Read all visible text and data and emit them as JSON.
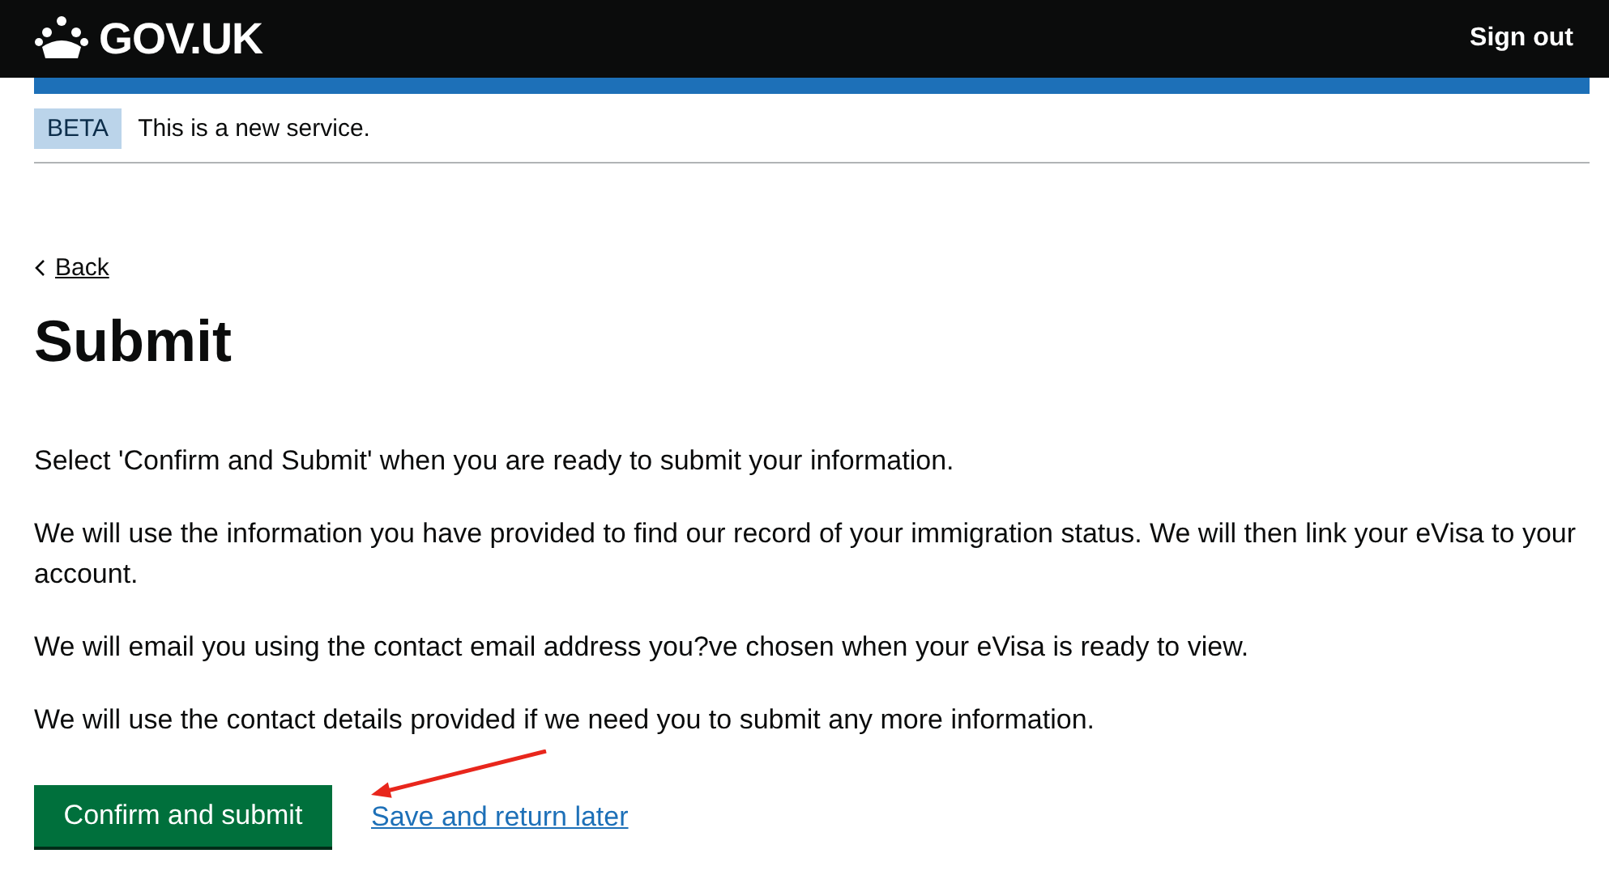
{
  "header": {
    "logo": "GOV.UK",
    "sign_out": "Sign out"
  },
  "phase_banner": {
    "tag": "BETA",
    "text": "This is a new service."
  },
  "back_link": "Back",
  "title": "Submit",
  "paragraphs": [
    "Select 'Confirm and Submit' when you are ready to submit your information.",
    "We will use the information you have provided to find our record of your immigration status. We will then link your eVisa to your account.",
    "We will email you using the contact email address you?ve chosen when your eVisa is ready to view.",
    "We will use the contact details provided if we need you to submit any more information."
  ],
  "actions": {
    "primary": "Confirm and submit",
    "secondary": "Save and return later"
  }
}
